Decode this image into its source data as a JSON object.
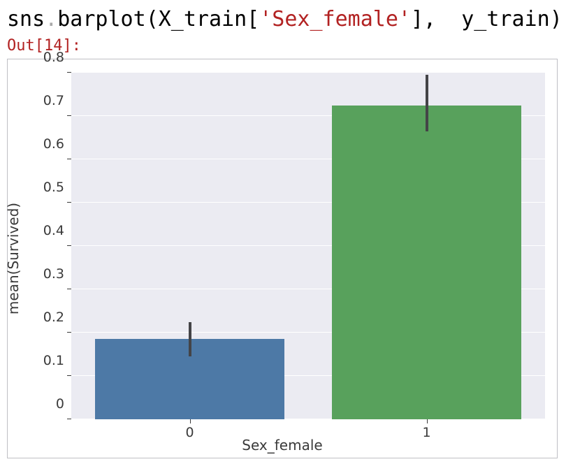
{
  "code": {
    "obj": "sns",
    "dot": ".",
    "method": "barplot",
    "open": "(",
    "arg1a": "X_train[",
    "arg1str": "'Sex_female'",
    "arg1b": "],  y_train",
    "close": ")"
  },
  "out_label": "Out[14]:",
  "chart_data": {
    "type": "bar",
    "categories": [
      "0",
      "1"
    ],
    "values": [
      0.185,
      0.725
    ],
    "error_low": [
      0.145,
      0.665
    ],
    "error_high": [
      0.225,
      0.795
    ],
    "xlabel": "Sex_female",
    "ylabel": "mean(Survived)",
    "ylim": [
      0.0,
      0.8
    ],
    "yticks": [
      0.0,
      0.1,
      0.2,
      0.3,
      0.4,
      0.5,
      0.6,
      0.7,
      0.8
    ],
    "colors": [
      "#4d79a6",
      "#58a15c"
    ]
  }
}
